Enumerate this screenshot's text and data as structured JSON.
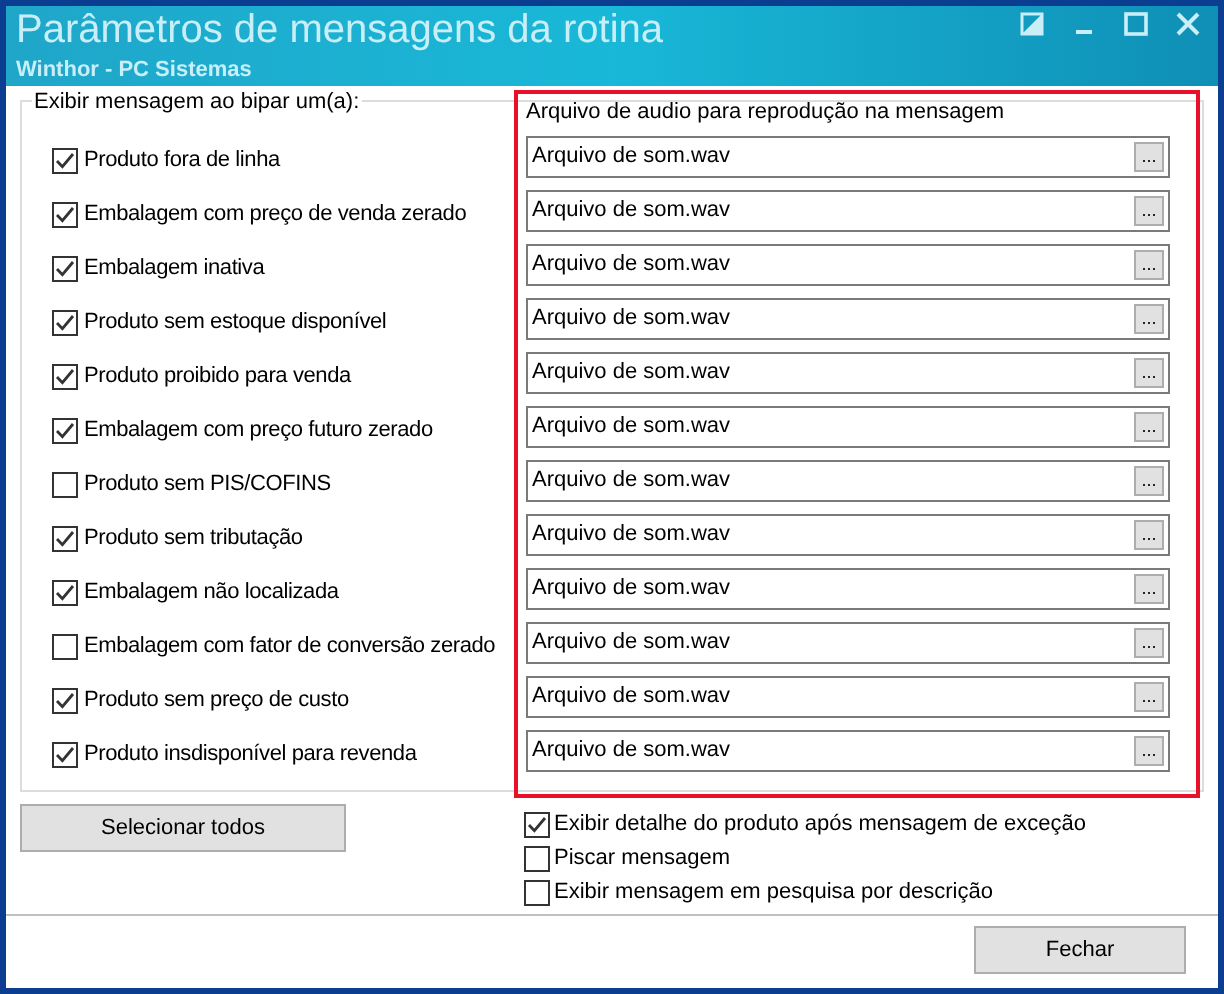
{
  "window": {
    "title": "Parâmetros de mensagens da rotina",
    "subtitle": "Winthor - PC Sistemas"
  },
  "group": {
    "label": "Exibir mensagem ao bipar um(a):",
    "audio_header": "Arquivo de audio para reprodução na mensagem"
  },
  "rows": [
    {
      "label": "Produto fora de linha",
      "checked": true,
      "file": "Arquivo de som.wav",
      "browse": "..."
    },
    {
      "label": "Embalagem com preço de venda zerado",
      "checked": true,
      "file": "Arquivo de som.wav",
      "browse": "..."
    },
    {
      "label": "Embalagem inativa",
      "checked": true,
      "file": "Arquivo de som.wav",
      "browse": "..."
    },
    {
      "label": "Produto sem estoque disponível",
      "checked": true,
      "file": "Arquivo de som.wav",
      "browse": "..."
    },
    {
      "label": "Produto proibido para venda",
      "checked": true,
      "file": "Arquivo de som.wav",
      "browse": "..."
    },
    {
      "label": "Embalagem com preço futuro zerado",
      "checked": true,
      "file": "Arquivo de som.wav",
      "browse": "..."
    },
    {
      "label": "Produto sem PIS/COFINS",
      "checked": false,
      "file": "Arquivo de som.wav",
      "browse": "..."
    },
    {
      "label": "Produto sem tributação",
      "checked": true,
      "file": "Arquivo de som.wav",
      "browse": "..."
    },
    {
      "label": "Embalagem não localizada",
      "checked": true,
      "file": "Arquivo de som.wav",
      "browse": "..."
    },
    {
      "label": "Embalagem com fator de conversão zerado",
      "checked": false,
      "file": "Arquivo de som.wav",
      "browse": "..."
    },
    {
      "label": "Produto sem preço de custo",
      "checked": true,
      "file": "Arquivo de som.wav",
      "browse": "..."
    },
    {
      "label": "Produto insdisponível para revenda",
      "checked": true,
      "file": "Arquivo de som.wav",
      "browse": "..."
    }
  ],
  "select_all_button": "Selecionar todos",
  "options": [
    {
      "label": "Exibir detalhe do produto após mensagem de exceção",
      "checked": true
    },
    {
      "label": "Piscar mensagem",
      "checked": false
    },
    {
      "label": "Exibir mensagem em pesquisa por descrição",
      "checked": false
    }
  ],
  "close_button": "Fechar"
}
